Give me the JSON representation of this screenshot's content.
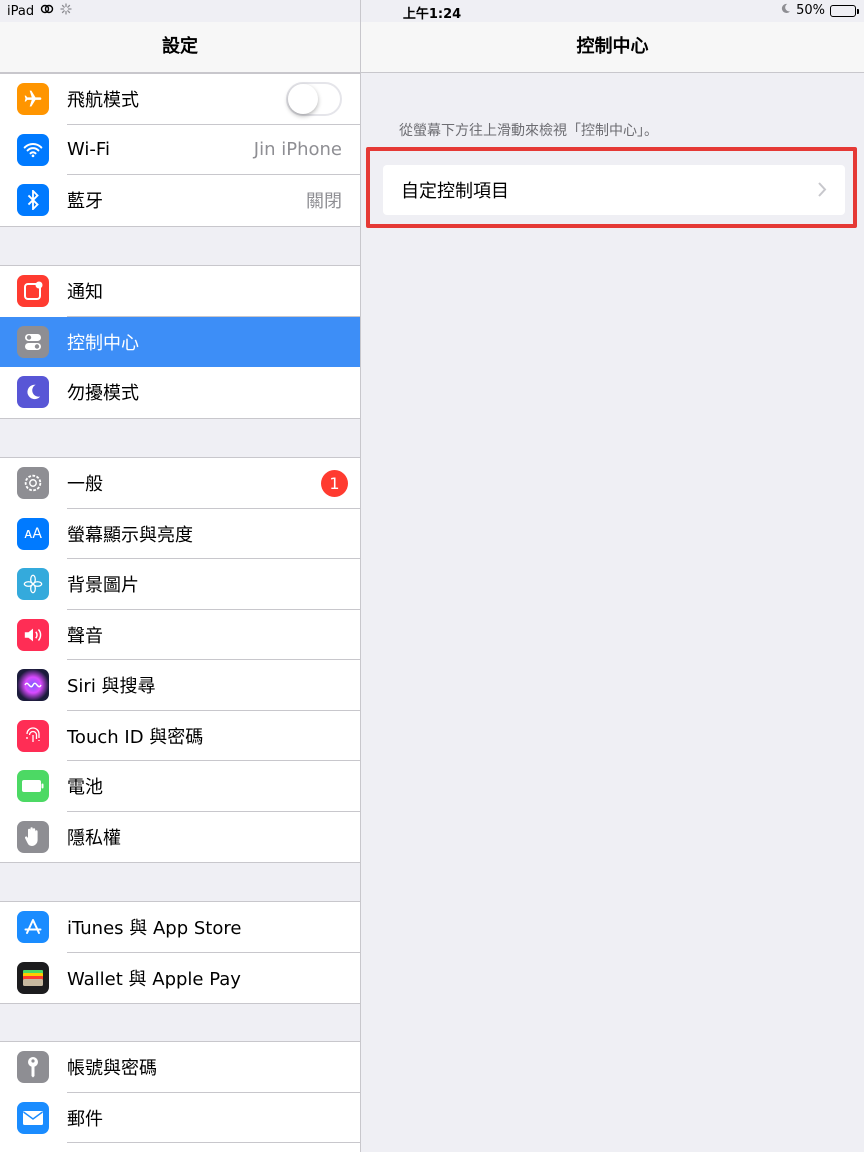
{
  "status_bar": {
    "device": "iPad",
    "time": "上午1:24",
    "battery": "50%",
    "battery_level": 0.5
  },
  "sidebar": {
    "title": "設定",
    "groups": [
      [
        {
          "label": "飛航模式",
          "icon": "airplane-icon",
          "color": "#ff9500",
          "toggle": false
        },
        {
          "label": "Wi-Fi",
          "icon": "wifi-icon",
          "color": "#007aff",
          "value": "Jin iPhone"
        },
        {
          "label": "藍牙",
          "icon": "bluetooth-icon",
          "color": "#007aff",
          "value": "關閉"
        }
      ],
      [
        {
          "label": "通知",
          "icon": "notifications-icon",
          "color": "#ff3b30"
        },
        {
          "label": "控制中心",
          "icon": "control-center-icon",
          "color": "#8e8e93",
          "selected": true
        },
        {
          "label": "勿擾模式",
          "icon": "moon-icon",
          "color": "#5856d6"
        }
      ],
      [
        {
          "label": "一般",
          "icon": "gear-icon",
          "color": "#8e8e93",
          "badge": "1"
        },
        {
          "label": "螢幕顯示與亮度",
          "icon": "display-icon",
          "color": "#007aff"
        },
        {
          "label": "背景圖片",
          "icon": "wallpaper-icon",
          "color": "#34aadc"
        },
        {
          "label": "聲音",
          "icon": "sound-icon",
          "color": "#ff2d55"
        },
        {
          "label": "Siri 與搜尋",
          "icon": "siri-icon",
          "color": "#1c1c3c"
        },
        {
          "label": "Touch ID 與密碼",
          "icon": "fingerprint-icon",
          "color": "#ff2d55"
        },
        {
          "label": "電池",
          "icon": "battery-icon",
          "color": "#4cd964"
        },
        {
          "label": "隱私權",
          "icon": "hand-icon",
          "color": "#8e8e93"
        }
      ],
      [
        {
          "label": "iTunes 與 App Store",
          "icon": "app-store-icon",
          "color": "#1a8cff"
        },
        {
          "label": "Wallet 與 Apple Pay",
          "icon": "wallet-icon",
          "color": "#1c1c1e"
        }
      ],
      [
        {
          "label": "帳號與密碼",
          "icon": "key-icon",
          "color": "#8e8e93"
        },
        {
          "label": "郵件",
          "icon": "mail-icon",
          "color": "#1a8cff"
        }
      ]
    ]
  },
  "detail": {
    "title": "控制中心",
    "description": "從螢幕下方往上滑動來檢視「控制中心」。",
    "customize_label": "自定控制項目"
  }
}
